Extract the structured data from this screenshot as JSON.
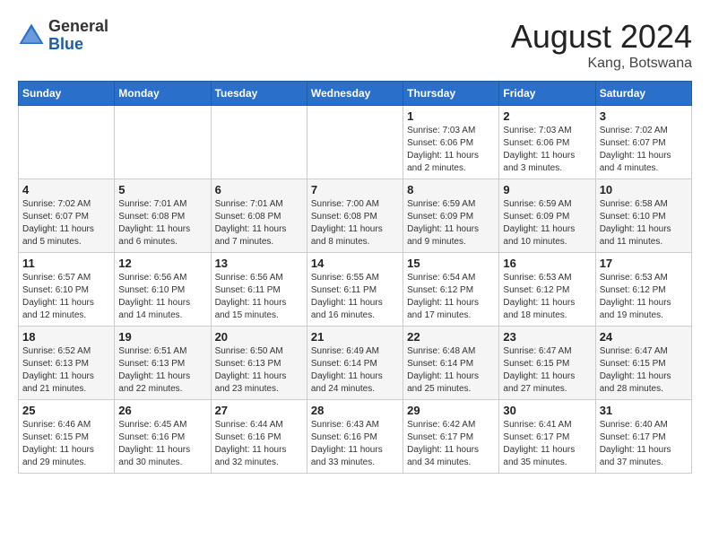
{
  "header": {
    "logo": {
      "general": "General",
      "blue": "Blue"
    },
    "title": "August 2024",
    "location": "Kang, Botswana"
  },
  "weekdays": [
    "Sunday",
    "Monday",
    "Tuesday",
    "Wednesday",
    "Thursday",
    "Friday",
    "Saturday"
  ],
  "weeks": [
    [
      {
        "day": "",
        "sunrise": "",
        "sunset": "",
        "daylight": ""
      },
      {
        "day": "",
        "sunrise": "",
        "sunset": "",
        "daylight": ""
      },
      {
        "day": "",
        "sunrise": "",
        "sunset": "",
        "daylight": ""
      },
      {
        "day": "",
        "sunrise": "",
        "sunset": "",
        "daylight": ""
      },
      {
        "day": "1",
        "sunrise": "Sunrise: 7:03 AM",
        "sunset": "Sunset: 6:06 PM",
        "daylight": "Daylight: 11 hours and 2 minutes."
      },
      {
        "day": "2",
        "sunrise": "Sunrise: 7:03 AM",
        "sunset": "Sunset: 6:06 PM",
        "daylight": "Daylight: 11 hours and 3 minutes."
      },
      {
        "day": "3",
        "sunrise": "Sunrise: 7:02 AM",
        "sunset": "Sunset: 6:07 PM",
        "daylight": "Daylight: 11 hours and 4 minutes."
      }
    ],
    [
      {
        "day": "4",
        "sunrise": "Sunrise: 7:02 AM",
        "sunset": "Sunset: 6:07 PM",
        "daylight": "Daylight: 11 hours and 5 minutes."
      },
      {
        "day": "5",
        "sunrise": "Sunrise: 7:01 AM",
        "sunset": "Sunset: 6:08 PM",
        "daylight": "Daylight: 11 hours and 6 minutes."
      },
      {
        "day": "6",
        "sunrise": "Sunrise: 7:01 AM",
        "sunset": "Sunset: 6:08 PM",
        "daylight": "Daylight: 11 hours and 7 minutes."
      },
      {
        "day": "7",
        "sunrise": "Sunrise: 7:00 AM",
        "sunset": "Sunset: 6:08 PM",
        "daylight": "Daylight: 11 hours and 8 minutes."
      },
      {
        "day": "8",
        "sunrise": "Sunrise: 6:59 AM",
        "sunset": "Sunset: 6:09 PM",
        "daylight": "Daylight: 11 hours and 9 minutes."
      },
      {
        "day": "9",
        "sunrise": "Sunrise: 6:59 AM",
        "sunset": "Sunset: 6:09 PM",
        "daylight": "Daylight: 11 hours and 10 minutes."
      },
      {
        "day": "10",
        "sunrise": "Sunrise: 6:58 AM",
        "sunset": "Sunset: 6:10 PM",
        "daylight": "Daylight: 11 hours and 11 minutes."
      }
    ],
    [
      {
        "day": "11",
        "sunrise": "Sunrise: 6:57 AM",
        "sunset": "Sunset: 6:10 PM",
        "daylight": "Daylight: 11 hours and 12 minutes."
      },
      {
        "day": "12",
        "sunrise": "Sunrise: 6:56 AM",
        "sunset": "Sunset: 6:10 PM",
        "daylight": "Daylight: 11 hours and 14 minutes."
      },
      {
        "day": "13",
        "sunrise": "Sunrise: 6:56 AM",
        "sunset": "Sunset: 6:11 PM",
        "daylight": "Daylight: 11 hours and 15 minutes."
      },
      {
        "day": "14",
        "sunrise": "Sunrise: 6:55 AM",
        "sunset": "Sunset: 6:11 PM",
        "daylight": "Daylight: 11 hours and 16 minutes."
      },
      {
        "day": "15",
        "sunrise": "Sunrise: 6:54 AM",
        "sunset": "Sunset: 6:12 PM",
        "daylight": "Daylight: 11 hours and 17 minutes."
      },
      {
        "day": "16",
        "sunrise": "Sunrise: 6:53 AM",
        "sunset": "Sunset: 6:12 PM",
        "daylight": "Daylight: 11 hours and 18 minutes."
      },
      {
        "day": "17",
        "sunrise": "Sunrise: 6:53 AM",
        "sunset": "Sunset: 6:12 PM",
        "daylight": "Daylight: 11 hours and 19 minutes."
      }
    ],
    [
      {
        "day": "18",
        "sunrise": "Sunrise: 6:52 AM",
        "sunset": "Sunset: 6:13 PM",
        "daylight": "Daylight: 11 hours and 21 minutes."
      },
      {
        "day": "19",
        "sunrise": "Sunrise: 6:51 AM",
        "sunset": "Sunset: 6:13 PM",
        "daylight": "Daylight: 11 hours and 22 minutes."
      },
      {
        "day": "20",
        "sunrise": "Sunrise: 6:50 AM",
        "sunset": "Sunset: 6:13 PM",
        "daylight": "Daylight: 11 hours and 23 minutes."
      },
      {
        "day": "21",
        "sunrise": "Sunrise: 6:49 AM",
        "sunset": "Sunset: 6:14 PM",
        "daylight": "Daylight: 11 hours and 24 minutes."
      },
      {
        "day": "22",
        "sunrise": "Sunrise: 6:48 AM",
        "sunset": "Sunset: 6:14 PM",
        "daylight": "Daylight: 11 hours and 25 minutes."
      },
      {
        "day": "23",
        "sunrise": "Sunrise: 6:47 AM",
        "sunset": "Sunset: 6:15 PM",
        "daylight": "Daylight: 11 hours and 27 minutes."
      },
      {
        "day": "24",
        "sunrise": "Sunrise: 6:47 AM",
        "sunset": "Sunset: 6:15 PM",
        "daylight": "Daylight: 11 hours and 28 minutes."
      }
    ],
    [
      {
        "day": "25",
        "sunrise": "Sunrise: 6:46 AM",
        "sunset": "Sunset: 6:15 PM",
        "daylight": "Daylight: 11 hours and 29 minutes."
      },
      {
        "day": "26",
        "sunrise": "Sunrise: 6:45 AM",
        "sunset": "Sunset: 6:16 PM",
        "daylight": "Daylight: 11 hours and 30 minutes."
      },
      {
        "day": "27",
        "sunrise": "Sunrise: 6:44 AM",
        "sunset": "Sunset: 6:16 PM",
        "daylight": "Daylight: 11 hours and 32 minutes."
      },
      {
        "day": "28",
        "sunrise": "Sunrise: 6:43 AM",
        "sunset": "Sunset: 6:16 PM",
        "daylight": "Daylight: 11 hours and 33 minutes."
      },
      {
        "day": "29",
        "sunrise": "Sunrise: 6:42 AM",
        "sunset": "Sunset: 6:17 PM",
        "daylight": "Daylight: 11 hours and 34 minutes."
      },
      {
        "day": "30",
        "sunrise": "Sunrise: 6:41 AM",
        "sunset": "Sunset: 6:17 PM",
        "daylight": "Daylight: 11 hours and 35 minutes."
      },
      {
        "day": "31",
        "sunrise": "Sunrise: 6:40 AM",
        "sunset": "Sunset: 6:17 PM",
        "daylight": "Daylight: 11 hours and 37 minutes."
      }
    ]
  ]
}
